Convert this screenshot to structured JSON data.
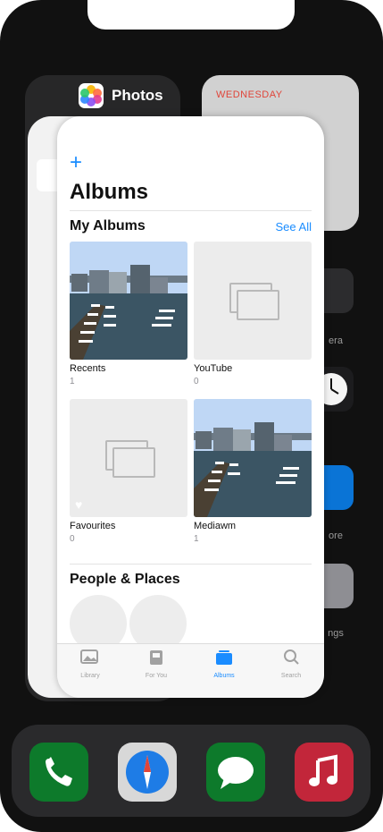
{
  "switcher": {
    "app_name": "Photos",
    "weekday": "WEDNESDAY"
  },
  "background_labels": [
    "era",
    "ore",
    "ngs"
  ],
  "albums_view": {
    "title": "Albums",
    "my_albums": {
      "label": "My Albums",
      "see_all": "See All",
      "albums": [
        {
          "name": "Recents",
          "count": "1"
        },
        {
          "name": "YouTube",
          "count": "0"
        },
        {
          "name": "Favourites",
          "count": "0"
        },
        {
          "name": "Mediawm",
          "count": "1"
        }
      ]
    },
    "people_places": {
      "label": "People & Places"
    }
  },
  "tabbar": {
    "items": [
      {
        "label": "Library",
        "icon": "library-icon"
      },
      {
        "label": "For You",
        "icon": "for-you-icon"
      },
      {
        "label": "Albums",
        "icon": "albums-icon",
        "active": true
      },
      {
        "label": "Search",
        "icon": "search-icon"
      }
    ]
  },
  "dock": {
    "apps": [
      "phone-icon",
      "safari-icon",
      "messages-icon",
      "music-icon"
    ]
  },
  "colors": {
    "accent": "#1a8cff",
    "weekday_red": "#e0453a"
  }
}
